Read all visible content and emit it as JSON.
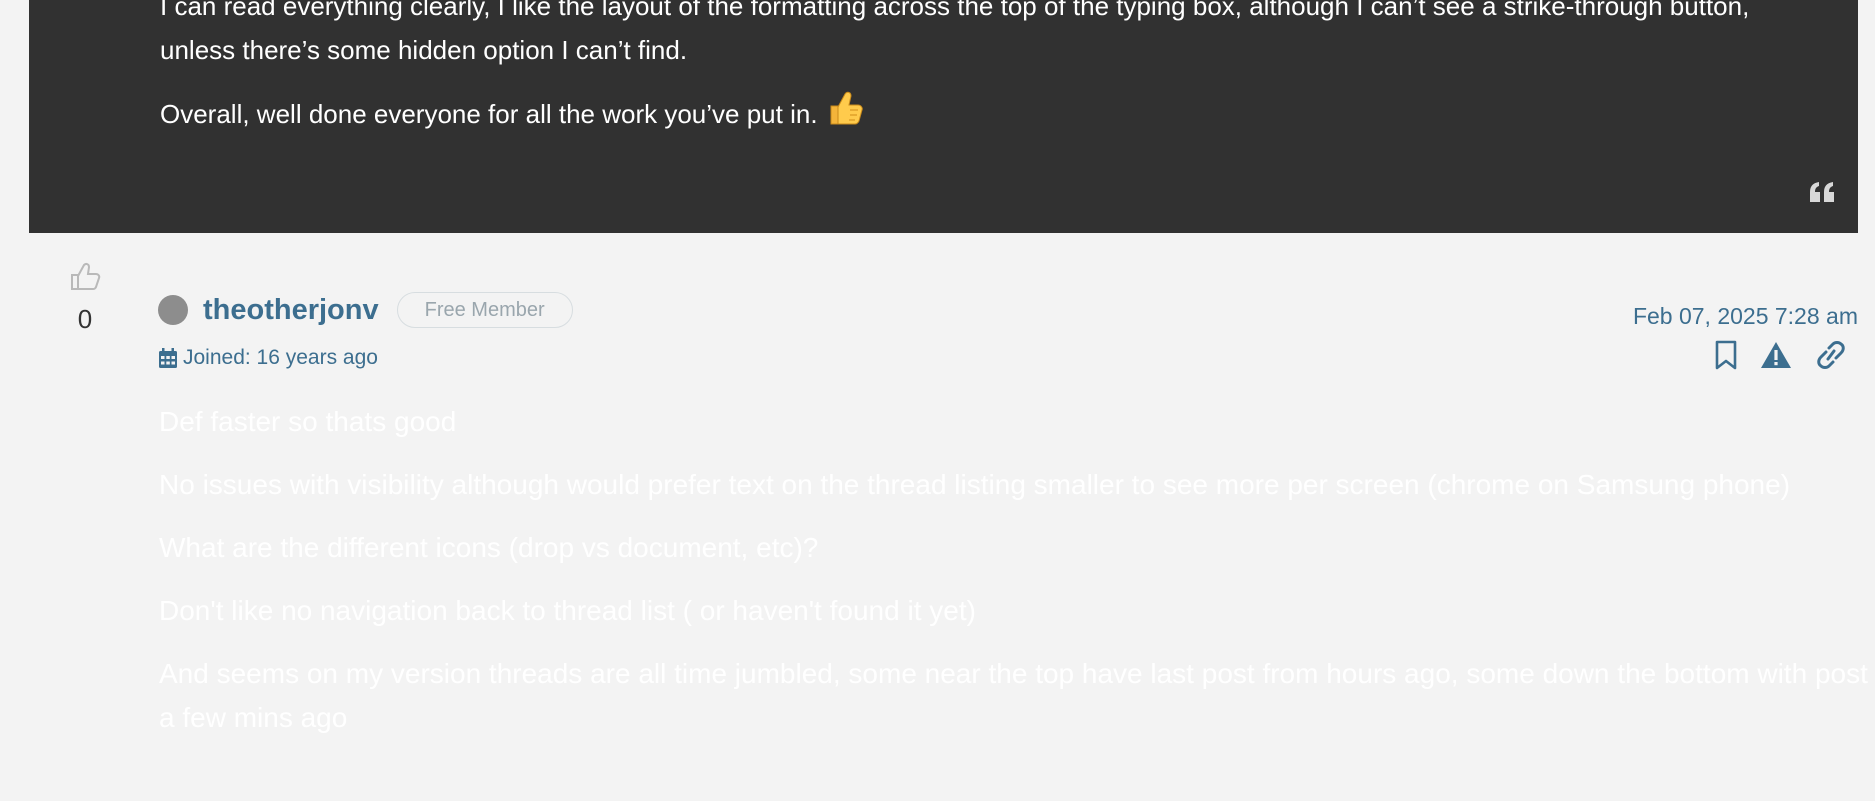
{
  "previous_post": {
    "paragraphs": [
      "I can read everything clearly, I like the layout of the formatting across the top of the typing box, although I can’t see a strike-through button, unless there’s some hidden option I can’t find.",
      "Overall, well done everyone for all the work you’ve put in."
    ],
    "emoji": "thumbs-up",
    "quote_icon": "quote-icon"
  },
  "post": {
    "likes": "0",
    "author": {
      "username": "theotherjonv",
      "role": "Free Member",
      "joined": "Joined: 16 years ago",
      "status_color": "#8d8d8d"
    },
    "date": "Feb 07, 2025 7:28 am",
    "actions": [
      "bookmark-icon",
      "report-icon",
      "link-icon"
    ],
    "paragraphs": [
      "Def faster so thats good",
      "No issues with visibility although would prefer text on the thread listing smaller to see more per screen (chrome on Samsung phone)",
      "What are the different icons (drop vs document, etc)?",
      "Don't like no navigation back to thread list ( or haven't found it yet)",
      "And seems on my version threads are all time jumbled, some near the top have last post from hours ago, some down the bottom with post a few mins ago"
    ]
  },
  "colors": {
    "dark_block": "#313131",
    "page_bg": "#f3f3f3",
    "accent": "#3c6e8f"
  }
}
